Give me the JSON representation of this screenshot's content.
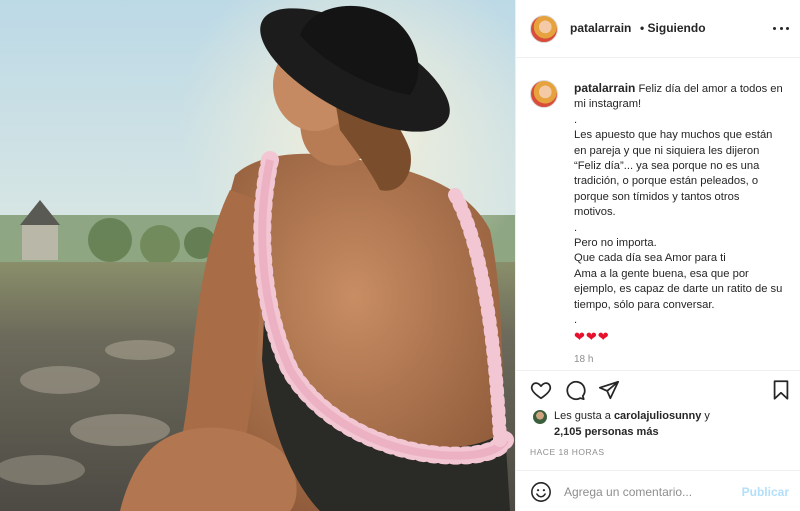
{
  "post": {
    "username": "patalarrain",
    "follow_status": "• Siguiendo",
    "caption": {
      "first_line": "Feliz día del amor a todos en mi instagram!",
      "paragraphs": [
        ".",
        "Les apuesto que hay muchos que están en pareja y que ni siquiera les dijeron “Feliz día”... ya sea porque no es una tradición, o porque están peleados, o porque son tímidos y tantos otros motivos.",
        ".",
        "Pero no importa.",
        "Que cada día sea Amor para ti",
        "Ama a la gente buena, esa que por ejemplo, es capaz de darte un ratito de su tiempo, sólo para conversar.",
        "."
      ],
      "hearts": "❤❤❤",
      "time": "18 h"
    },
    "likes": {
      "prefix": "Les gusta a",
      "user": "carolajuliosunny",
      "connector": "y",
      "others": "2,105 personas más"
    },
    "timestamp": "HACE 18 HORAS",
    "comment": {
      "placeholder": "Agrega un comentario...",
      "publish": "Publicar"
    }
  },
  "icons": {
    "more": "more-options-icon",
    "like": "heart-outline-icon",
    "comment": "comment-bubble-icon",
    "share": "paper-plane-icon",
    "save": "bookmark-icon",
    "emoji": "emoji-smile-icon"
  },
  "colors": {
    "accent_disabled": "#b2dffc",
    "heart_red": "#e8112d",
    "muted": "#8e8e8e"
  }
}
